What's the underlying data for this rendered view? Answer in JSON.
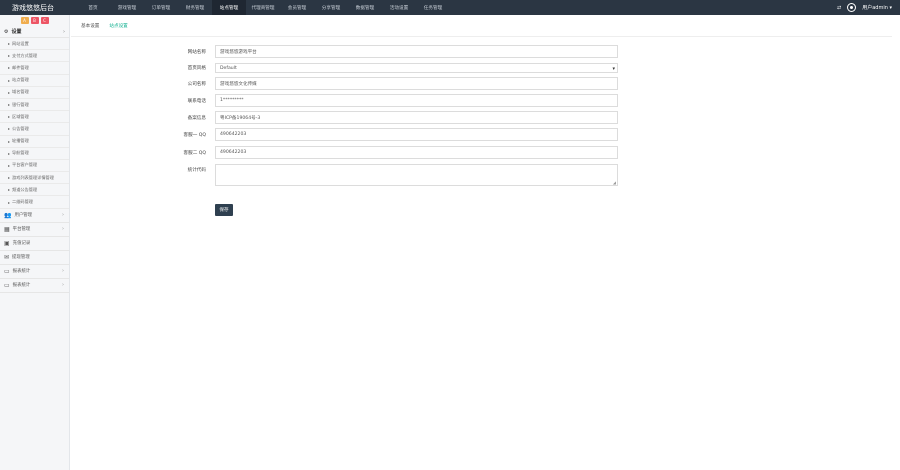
{
  "app": {
    "title": "游戏悠悠后台"
  },
  "nav": {
    "items": [
      "首页",
      "游戏管理",
      "订单管理",
      "财务管理",
      "站点管理",
      "代理商管理",
      "会员管理",
      "分享管理",
      "数据管理",
      "活动设置",
      "任务管理"
    ],
    "active_index": 4
  },
  "user": {
    "name": "用户admin ▾"
  },
  "sidebar": {
    "quick_buttons": [
      {
        "label": "A",
        "color": "#f0ad4e"
      },
      {
        "label": "B",
        "color": "#ed5565"
      },
      {
        "label": "C",
        "color": "#ed5565"
      }
    ],
    "section_title": "设置",
    "section_arrow": "›",
    "sub_items": [
      "网站设置",
      "支付方式管理",
      "邮件管理",
      "站点管理",
      "域名管理",
      "银行管理",
      "区域管理",
      "公告管理",
      "轮播管理",
      "导航管理",
      "平台客户管理",
      "游戏列表管理详情管理",
      "频道公告管理",
      "二维码管理"
    ],
    "groups": [
      {
        "icon": "👥",
        "label": "用户管理",
        "arrow": "›"
      },
      {
        "icon": "▦",
        "label": "平台管理",
        "arrow": "›"
      },
      {
        "icon": "▣",
        "label": "充值记录",
        "arrow": ""
      },
      {
        "icon": "✉",
        "label": "提现管理",
        "arrow": ""
      },
      {
        "icon": "▭",
        "label": "报表统计",
        "arrow": "›"
      },
      {
        "icon": "▭",
        "label": "报表统计",
        "arrow": "›"
      }
    ]
  },
  "tabs": [
    {
      "label": "基本设置",
      "active": false
    },
    {
      "label": "站点设置",
      "active": true
    }
  ],
  "form": {
    "fields": [
      {
        "label": "网站名称",
        "value": "游戏悠悠游戏平台",
        "type": "text"
      },
      {
        "label": "首页风格",
        "value": "Default",
        "type": "select"
      },
      {
        "label": "公司名称",
        "value": "游戏悠悠文化传媒",
        "type": "text"
      },
      {
        "label": "联系电话",
        "value": "1*********",
        "type": "text"
      },
      {
        "label": "备案信息",
        "value": "粤ICP备19064号-3",
        "type": "text"
      },
      {
        "label": "客服一 QQ",
        "value": "490642203",
        "type": "text"
      },
      {
        "label": "客服二 QQ",
        "value": "490642203",
        "type": "text"
      },
      {
        "label": "统计代码",
        "value": "",
        "type": "textarea"
      }
    ],
    "save_label": "保存"
  }
}
